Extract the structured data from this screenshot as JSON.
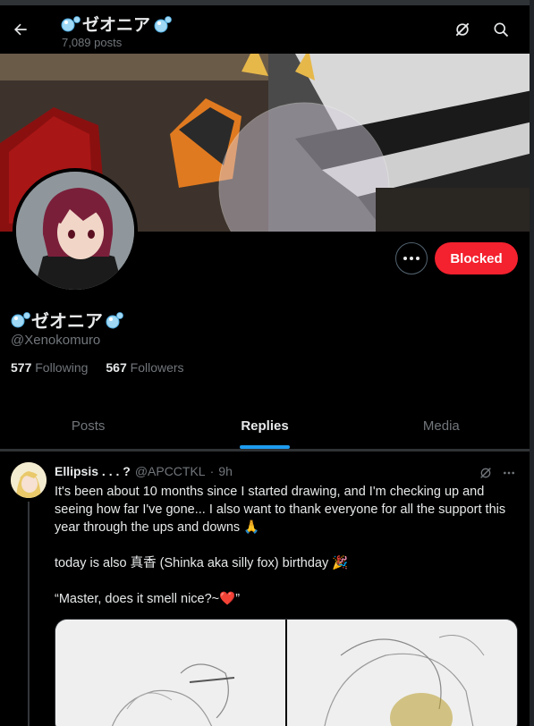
{
  "header": {
    "display_name": "ゼオニア",
    "post_count": "7,089 posts"
  },
  "profile": {
    "display_name": "ゼオニア",
    "handle": "@Xenokomuro",
    "following_count": "577",
    "following_label": "Following",
    "followers_count": "567",
    "followers_label": "Followers",
    "blocked_label": "Blocked"
  },
  "tabs": [
    {
      "label": "Posts",
      "active": false
    },
    {
      "label": "Replies",
      "active": true
    },
    {
      "label": "Media",
      "active": false
    }
  ],
  "tweet": {
    "author_name": "Ellipsis . . . ?",
    "author_handle": "@APCCTKL",
    "separator": "·",
    "time": "9h",
    "line1": "It's been about 10 months since I started drawing, and I'm checking up and seeing how far I've gone... I also want to thank everyone for all the support this year through the ups and downs 🙏",
    "line2": "today is also 真香 (Shinka aka silly fox) birthday 🎉",
    "line3": "“Master, does it smell nice?~❤️”"
  },
  "colors": {
    "background": "#000000",
    "accent": "#1d9bf0",
    "blocked": "#f4212e",
    "secondary_text": "#71767b",
    "bubble_emoji": "#7cc4ee"
  },
  "icons": {
    "back": "arrow-left-icon",
    "grok": "grok-icon",
    "search": "search-icon",
    "more": "more-dots-icon",
    "bubble": "bubbles-emoji-icon"
  }
}
